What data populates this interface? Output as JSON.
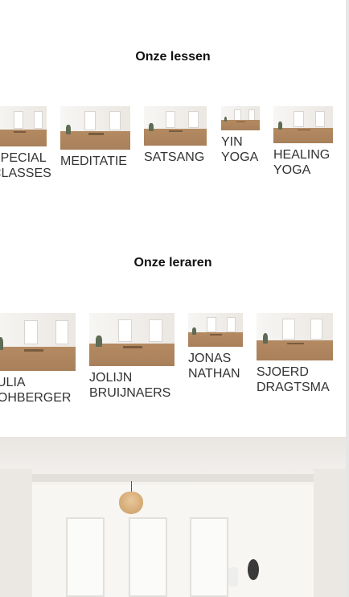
{
  "lessons": {
    "title": "Onze lessen",
    "items": [
      {
        "label": "SPECIAL CLASSES",
        "line1": "SPECIAL",
        "line2": "CLASSES"
      },
      {
        "label": "MEDITATIE",
        "line1": "MEDITATIE",
        "line2": ""
      },
      {
        "label": "SATSANG",
        "line1": "SATSANG",
        "line2": ""
      },
      {
        "label": "YIN YOGA",
        "line1": "YIN",
        "line2": "YOGA"
      },
      {
        "label": "HEALING YOGA",
        "line1": "HEALING",
        "line2": "YOGA"
      }
    ]
  },
  "teachers": {
    "title": "Onze leraren",
    "items": [
      {
        "label": "JULIA LOHBERGER",
        "line1": "JULIA",
        "line2": "LOHBERGER"
      },
      {
        "label": "JOLIJN BRUIJNAERS",
        "line1": "JOLIJN",
        "line2": "BRUIJNAERS"
      },
      {
        "label": "JONAS NATHAN",
        "line1": "JONAS",
        "line2": "NATHAN"
      },
      {
        "label": "SJOERD DRAGTSMA",
        "line1": "SJOERD",
        "line2": "DRAGTSMA"
      }
    ]
  },
  "colors": {
    "background": "#ffffff",
    "text": "#333333",
    "floor": "#b48a62"
  }
}
